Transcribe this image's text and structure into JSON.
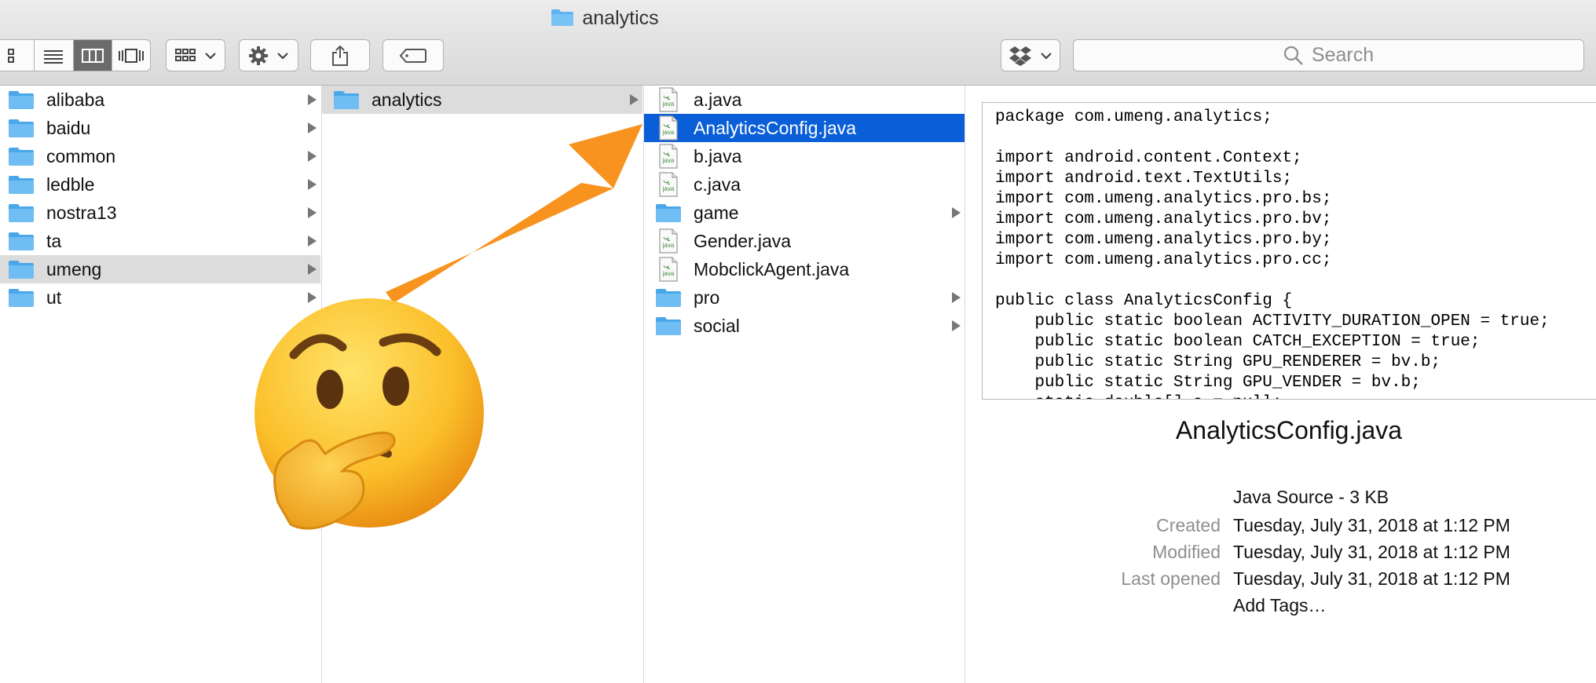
{
  "window": {
    "title": "analytics"
  },
  "toolbar": {
    "view_buttons": [
      "icon-view-icon",
      "list-view-icon",
      "column-view-icon",
      "cover-flow-icon"
    ],
    "active_view": "column-view-icon",
    "search_placeholder": "Search"
  },
  "columns": [
    {
      "items": [
        {
          "label": "alibaba",
          "kind": "folder"
        },
        {
          "label": "baidu",
          "kind": "folder"
        },
        {
          "label": "common",
          "kind": "folder"
        },
        {
          "label": "ledble",
          "kind": "folder"
        },
        {
          "label": "nostra13",
          "kind": "folder"
        },
        {
          "label": "ta",
          "kind": "folder"
        },
        {
          "label": "umeng",
          "kind": "folder",
          "selected": true
        },
        {
          "label": "ut",
          "kind": "folder"
        }
      ]
    },
    {
      "items": [
        {
          "label": "analytics",
          "kind": "folder",
          "selected": true
        }
      ]
    },
    {
      "items": [
        {
          "label": "a.java",
          "kind": "java"
        },
        {
          "label": "AnalyticsConfig.java",
          "kind": "java",
          "selected": true
        },
        {
          "label": "b.java",
          "kind": "java"
        },
        {
          "label": "c.java",
          "kind": "java"
        },
        {
          "label": "game",
          "kind": "folder"
        },
        {
          "label": "Gender.java",
          "kind": "java"
        },
        {
          "label": "MobclickAgent.java",
          "kind": "java"
        },
        {
          "label": "pro",
          "kind": "folder"
        },
        {
          "label": "social",
          "kind": "folder"
        }
      ]
    }
  ],
  "preview": {
    "code": "package com.umeng.analytics;\n\nimport android.content.Context;\nimport android.text.TextUtils;\nimport com.umeng.analytics.pro.bs;\nimport com.umeng.analytics.pro.bv;\nimport com.umeng.analytics.pro.by;\nimport com.umeng.analytics.pro.cc;\n\npublic class AnalyticsConfig {\n    public static boolean ACTIVITY_DURATION_OPEN = true;\n    public static boolean CATCH_EXCEPTION = true;\n    public static String GPU_RENDERER = bv.b;\n    public static String GPU_VENDER = bv.b;\n    static double[] a = null;",
    "file_name": "AnalyticsConfig.java",
    "kind": "Java Source - 3 KB",
    "created_label": "Created",
    "created": "Tuesday, July 31, 2018 at 1:12 PM",
    "modified_label": "Modified",
    "modified": "Tuesday, July 31, 2018 at 1:12 PM",
    "last_opened_label": "Last opened",
    "last_opened": "Tuesday, July 31, 2018 at 1:12 PM",
    "add_tags": "Add Tags…"
  },
  "colors": {
    "selection": "#0a5fd8",
    "folder": "#5db4f0",
    "arrow": "#f7931e",
    "link": "#1f7ae0"
  },
  "overlay": {
    "arrow": "orange-arrow",
    "emoji": "thinking-face-emoji"
  }
}
